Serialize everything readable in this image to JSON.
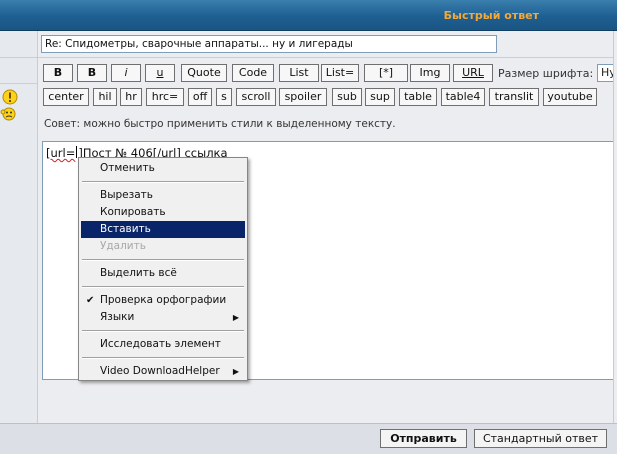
{
  "header": {
    "title": "Быстрый ответ"
  },
  "subject": {
    "value": "Re: Спидометры, сварочные аппараты... ну и лигерады"
  },
  "toolbar": {
    "row1": [
      "B",
      "B",
      "i",
      "u",
      "Quote",
      "Code",
      "List",
      "List=",
      "[*]",
      "Img",
      "URL"
    ],
    "row2": [
      "center",
      "hil",
      "hr",
      "hrc=",
      "off",
      "s",
      "scroll",
      "spoiler",
      "sub",
      "sup",
      "table",
      "table4",
      "translit",
      "youtube"
    ],
    "fontsize_label": "Размер шрифта:",
    "fontsize_value": "Ну"
  },
  "tip": "Совет: можно быстро применить стили к выделенному тексту.",
  "editor": {
    "part1": "[url=",
    "part2": "]Пост № 406[/url] ссылка"
  },
  "context_menu": {
    "undo": "Отменить",
    "cut": "Вырезать",
    "copy": "Копировать",
    "paste": "Вставить",
    "delete": "Удалить",
    "select_all": "Выделить всё",
    "spellcheck": "Проверка орфографии",
    "languages": "Языки",
    "inspect": "Исследовать элемент",
    "video": "Video DownloadHelper"
  },
  "footer": {
    "submit": "Отправить",
    "standard_reply": "Стандартный ответ"
  },
  "colors": {
    "header_bg": "#1e5f91",
    "header_title": "#f3a93a",
    "menu_highlight": "#0a246a"
  }
}
